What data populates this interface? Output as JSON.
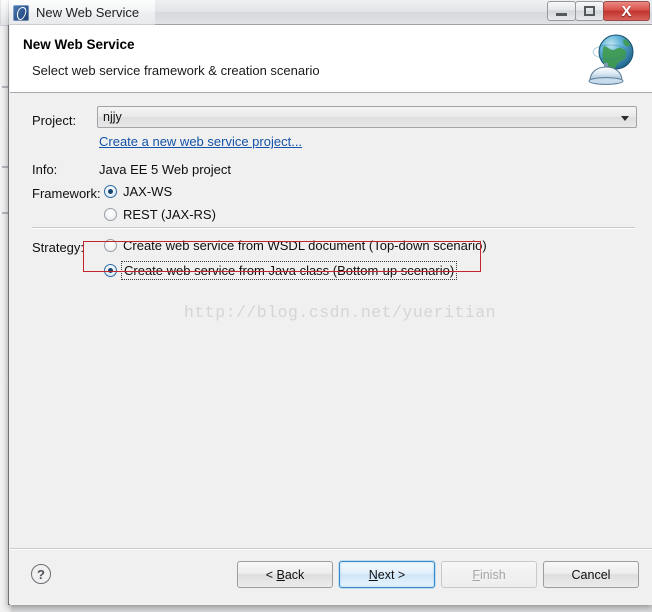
{
  "window": {
    "title": "New Web Service",
    "app_icon": "web-service-icon",
    "controls": {
      "minimize": "—",
      "maximize": "□",
      "close": "X"
    }
  },
  "header": {
    "title": "New Web Service",
    "subtitle": "Select web service framework & creation scenario",
    "icon": "globe-web-service-icon"
  },
  "form": {
    "project": {
      "label": "Project:",
      "value": "njjy",
      "dropdown_icon": "chevron-down-icon"
    },
    "create_project_link": "Create a new web service project...",
    "info": {
      "label": "Info:",
      "value": "Java EE 5 Web project"
    },
    "framework": {
      "label": "Framework:",
      "options": [
        {
          "label": "JAX-WS",
          "selected": true
        },
        {
          "label": "REST (JAX-RS)",
          "selected": false
        }
      ]
    },
    "strategy": {
      "label": "Strategy:",
      "options": [
        {
          "label": "Create web service from WSDL document (Top-down scenario)",
          "selected": false
        },
        {
          "label": "Create web service from Java class (Bottom-up scenario)",
          "selected": true
        }
      ]
    }
  },
  "annotation": {
    "highlight_color": "#c0262b",
    "target": "Create web service from Java class (Bottom-up scenario)"
  },
  "watermark": "http://blog.csdn.net/yueritian",
  "footer": {
    "help_label": "?",
    "buttons": [
      {
        "label": "< Back",
        "mnemonic": "B",
        "state": "enabled"
      },
      {
        "label": "Next >",
        "mnemonic": "N",
        "state": "default"
      },
      {
        "label": "Finish",
        "mnemonic": "F",
        "state": "disabled"
      },
      {
        "label": "Cancel",
        "mnemonic": "",
        "state": "enabled"
      }
    ]
  },
  "colors": {
    "accent": "#1553a8",
    "annotation": "#c0262b",
    "dialog_bg": "#f0f0f0",
    "header_bg": "#ffffff"
  }
}
